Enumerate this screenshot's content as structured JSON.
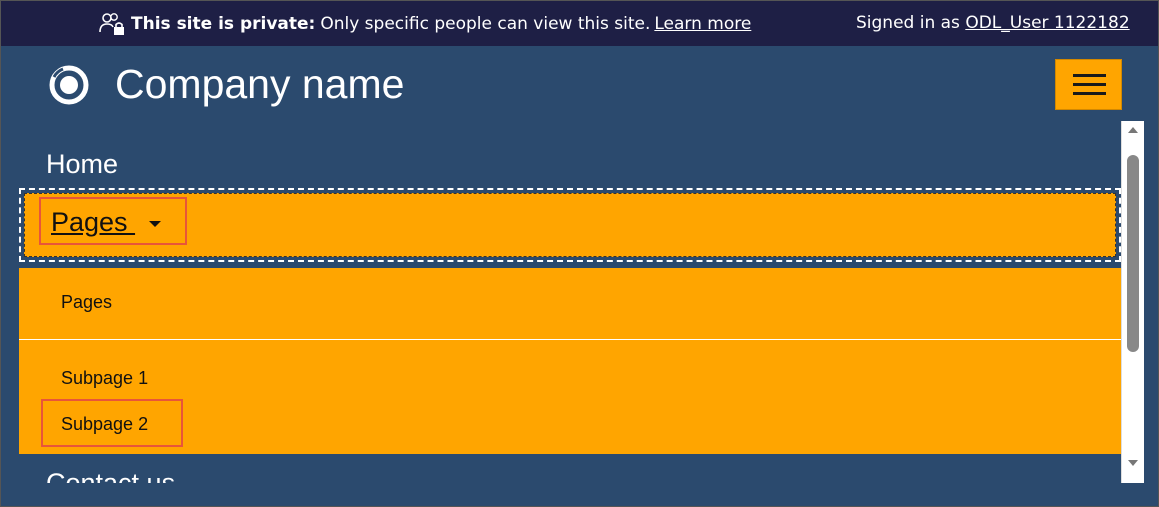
{
  "banner": {
    "notice_bold": "This site is private:",
    "notice_text": "Only specific people can view this site.",
    "learn_more": "Learn more",
    "signed_in_prefix": "Signed in as",
    "user_name": "ODL_User 1122182",
    "icon": "people-lock-icon"
  },
  "header": {
    "company_name": "Company name",
    "logo_icon": "ring-logo-icon",
    "menu_icon": "hamburger-icon"
  },
  "nav": {
    "home": "Home",
    "pages": "Pages ",
    "submenu": [
      "Pages",
      "Subpage 1",
      "Subpage 2"
    ],
    "contact": "Contact us"
  },
  "colors": {
    "banner_bg": "#1e1f45",
    "page_bg": "#2b4a6e",
    "accent": "#ffa500",
    "highlight_box": "#e8553a"
  }
}
